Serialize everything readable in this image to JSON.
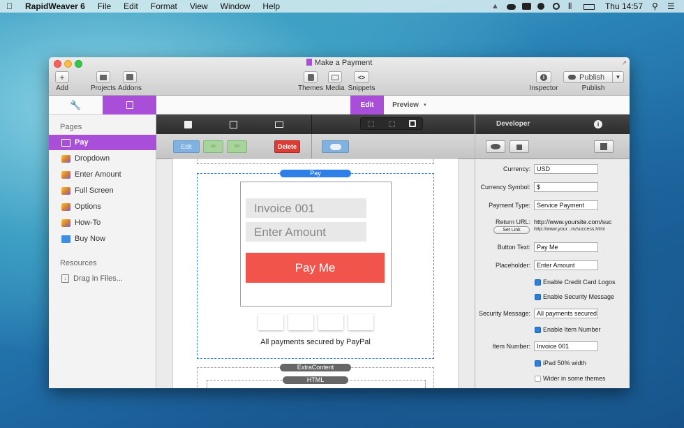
{
  "menubar": {
    "app": "RapidWeaver 6",
    "items": [
      "File",
      "Edit",
      "Format",
      "View",
      "Window",
      "Help"
    ],
    "clock": "Thu 14:57"
  },
  "window": {
    "title": "Make a Payment"
  },
  "toolbar": {
    "add": "Add",
    "projects": "Projects",
    "addons": "Addons",
    "themes": "Themes",
    "media": "Media",
    "snippets": "Snippets",
    "inspector": "Inspector",
    "publish_btn": "Publish",
    "publish": "Publish"
  },
  "tabs": {
    "edit": "Edit",
    "preview": "Preview"
  },
  "sidebar": {
    "pages_header": "Pages",
    "pages": [
      "Pay",
      "Dropdown",
      "Enter Amount",
      "Full Screen",
      "Options",
      "How-To",
      "Buy Now"
    ],
    "resources_header": "Resources",
    "resource_item": "Drag in Files..."
  },
  "editbar": {
    "edit": "Edit",
    "delete": "Delete"
  },
  "canvas": {
    "pay_tag": "Pay",
    "invoice": "Invoice 001",
    "amount": "Enter Amount",
    "pay_btn": "Pay Me",
    "secured": "All payments secured by PayPal",
    "extra_tag": "ExtraContent",
    "html_tag": "HTML"
  },
  "inspector": {
    "header": "Developer",
    "currency_label": "Currency:",
    "currency": "USD",
    "symbol_label": "Currency Symbol:",
    "symbol": "$",
    "ptype_label": "Payment Type:",
    "ptype": "Service Payment",
    "return_label": "Return URL:",
    "return_url": "http://www.yoursite.com/suc",
    "set_link": "Set Link",
    "return_short": "http://www.your...m/success.html",
    "btntext_label": "Button Text:",
    "btntext": "Pay Me",
    "placeholder_label": "Placeholder:",
    "placeholder": "Enter Amount",
    "cc_logos": "Enable Credit Card Logos",
    "security_msg_opt": "Enable Security Message",
    "secmsg_label": "Security Message:",
    "secmsg": "All payments secured",
    "item_number_opt": "Enable Item Number",
    "itemnum_label": "Item Number:",
    "itemnum": "Invoice 001",
    "ipad": "iPad 50% width",
    "wider": "Wider in some themes"
  },
  "colors": {
    "accent": "#a94ed9",
    "pay_button": "#f0544a",
    "tag_blue": "#2f7fe8",
    "delete_red": "#dd3b33"
  }
}
